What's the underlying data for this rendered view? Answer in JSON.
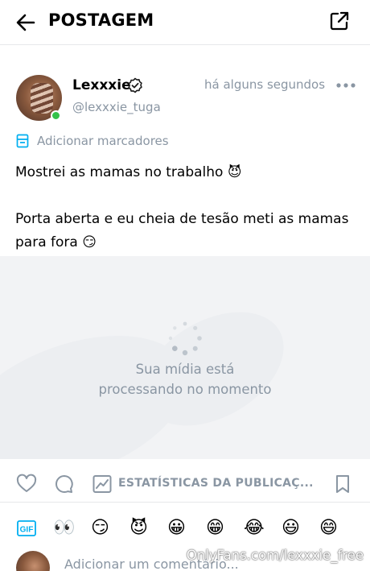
{
  "header": {
    "title": "POSTAGEM",
    "back_icon": "arrow-left-icon",
    "share_icon": "share-icon"
  },
  "post": {
    "author_name": "Lexxxie",
    "author_handle": "@lexxxie_tuga",
    "timestamp": "há alguns segundos",
    "bookmark_label": "Adicionar marcadores",
    "line1": "Mostrei as mamas no trabalho",
    "line1_emoji": "😈",
    "line2": "Porta aberta e eu cheia de tesão meti as mamas para fora",
    "line2_emoji": "😏"
  },
  "media": {
    "processing_line1": "Sua mídia está",
    "processing_line2": "processando no momento"
  },
  "actions": {
    "stats_label": "ESTATÍSTICAS DA PUBLICAÇ..."
  },
  "emoji_bar": {
    "gif_label": "GIF",
    "emojis": [
      "👀",
      "😏",
      "😈",
      "😀",
      "😁",
      "😂",
      "😃",
      "😄"
    ]
  },
  "comment": {
    "placeholder": "Adicionar um comentário...",
    "watermark": "OnlyFans.com/lexxxie_free"
  },
  "colors": {
    "accent": "#00aff0",
    "muted": "#8a96a3",
    "online": "#34c24a",
    "media_bg": "#f2f3f5"
  }
}
